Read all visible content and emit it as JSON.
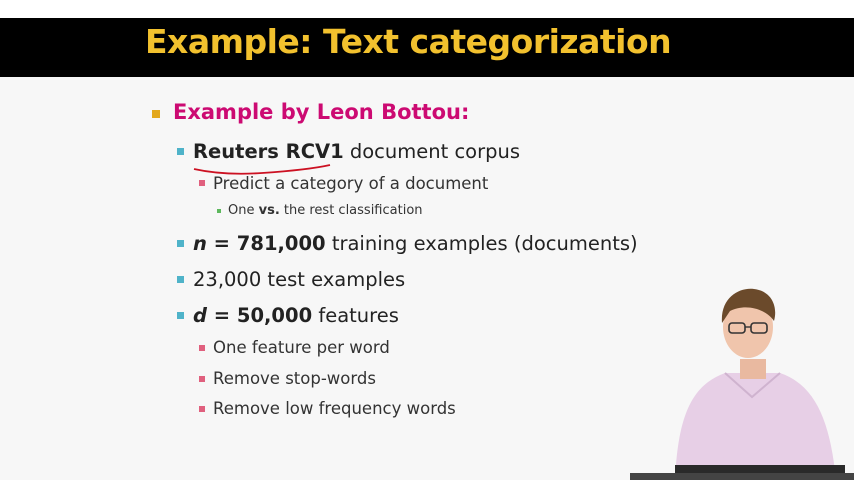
{
  "slide": {
    "title": "Example: Text categorization",
    "items": [
      {
        "level": 1,
        "text": "Example by Leon Bottou:"
      },
      {
        "level": 2,
        "bold": "Reuters RCV1",
        "text": " document corpus"
      },
      {
        "level": 3,
        "text": "Predict a category of a document"
      },
      {
        "level": 4,
        "pre": "One ",
        "bold": "vs.",
        "text": " the rest classification"
      },
      {
        "level": 2,
        "bold_italic": "n",
        "bold": " = 781,000",
        "text": " training examples (documents)"
      },
      {
        "level": 2,
        "text": "23,000 test examples"
      },
      {
        "level": 2,
        "bold_italic": "d",
        "bold": " = 50,000",
        "text": " features"
      },
      {
        "level": 3,
        "text": "One feature per word"
      },
      {
        "level": 3,
        "text": "Remove stop-words"
      },
      {
        "level": 3,
        "text": "Remove low frequency words"
      }
    ]
  },
  "colors": {
    "title_text": "#f2c12e",
    "title_bar": "#000000",
    "level1_text": "#cc0a72",
    "bullet_l1": "#e3a81c",
    "bullet_l2": "#4fb3c9",
    "bullet_l3": "#e0607e",
    "bullet_l4": "#5db85d",
    "annotation": "#cc1122"
  }
}
